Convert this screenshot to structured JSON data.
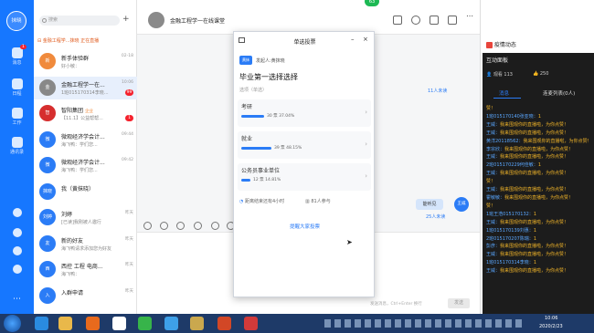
{
  "user": {
    "avatar_text": "抹晓"
  },
  "sidebar": {
    "items": [
      {
        "label": "消息",
        "badge": "1"
      },
      {
        "label": "日程"
      },
      {
        "label": "工作"
      },
      {
        "label": "通讯录"
      }
    ]
  },
  "search": {
    "placeholder": "搜索"
  },
  "pinned_notice": "金融工程学...抹晓 正在直播",
  "conversations": [
    {
      "name": "新手体验群",
      "msg": "好小敏：",
      "time": "02-18",
      "avatar": "新",
      "color": "#f08a3c"
    },
    {
      "name": "金融工程学一在...",
      "msg": "1班015170314李晓...",
      "time": "10:06",
      "badge": "99",
      "avatar": "金",
      "color": "#888888"
    },
    {
      "name": "智阳集团",
      "tag": "企业",
      "msg": "【11.1】公益帮帮...",
      "time": "",
      "badge": "1",
      "avatar": "智",
      "color": "#d62e2e"
    },
    {
      "name": "微观经济学会计...",
      "msg": "海飞鸭：学们您...",
      "time": "09:44",
      "avatar": "微",
      "color": "#2b7cf6"
    },
    {
      "name": "微观经济学会计...",
      "msg": "海飞鸭：学们您...",
      "time": "09:42",
      "avatar": "微",
      "color": "#2b7cf6"
    },
    {
      "name": "我（黄抹晓）",
      "msg": "",
      "time": "",
      "avatar": "抹晓",
      "color": "#2b7cf6"
    },
    {
      "name": "刘婷",
      "msg": "[已读]我刚被人邀行",
      "time": "昨天",
      "avatar": "刘婷",
      "color": "#2b7cf6"
    },
    {
      "name": "新的好友",
      "msg": "海飞鸭请求添加您为好友",
      "time": "昨天",
      "avatar": "友",
      "color": "#2b7cf6"
    },
    {
      "name": "西控 工程 电商...",
      "msg": "海飞鸭：",
      "time": "昨天",
      "avatar": "西",
      "color": "#2b7cf6"
    },
    {
      "name": "入群申请",
      "msg": "",
      "time": "昨天",
      "avatar": "入",
      "color": "#2b7cf6"
    }
  ],
  "chat": {
    "title": "金融工程学一在线课堂",
    "unread_top": "11人未读",
    "unread_bottom": "25人未读",
    "bubble": "能听见",
    "bubble_name": "王威",
    "input_hint": "发送消息，Ctrl+Enter 换行",
    "send": "发送"
  },
  "online_badge": "63",
  "poll": {
    "window_title": "单选投票",
    "author": "发起人:黄抹晓",
    "author_avatar": "黄抹",
    "question": "毕业第一选择选择",
    "type": "选项（单选）",
    "options": [
      {
        "label": "考研",
        "votes": "30 票",
        "pct_text": "37.04%",
        "pct": 37.04
      },
      {
        "label": "就业",
        "votes": "39 票",
        "pct_text": "48.15%",
        "pct": 48.15
      },
      {
        "label": "公务员事业单位",
        "votes": "12 票",
        "pct_text": "14.81%",
        "pct": 14.81
      }
    ],
    "deadline": "距离结束还有4小时",
    "participants": "81人参与",
    "remind": "提醒大家投票"
  },
  "right_panel": {
    "title": "疫情动态",
    "live_title": "互动面板",
    "viewers": "观看 113",
    "likes": "250",
    "tabs": [
      "消息",
      "连麦列表(0人)"
    ],
    "messages": [
      {
        "name": "",
        "text": "赞！"
      },
      {
        "name": "1班015170140张亚晓：",
        "text": "1"
      },
      {
        "name": "王威：",
        "text": "我来围观你的直播啦，为你点赞！"
      },
      {
        "name": "王威：",
        "text": "我来围观你的直播啦，为你点赞！"
      },
      {
        "name": "黄洋20118562：",
        "text": "我来围观你的直播啦，为你点赞！"
      },
      {
        "name": "李宗欣：",
        "text": "我来围观你的直播啦，为你点赞！"
      },
      {
        "name": "王威：",
        "text": "我来围观你的直播啦，为你点赞！"
      },
      {
        "name": "2班015170229何佳敏：",
        "text": "1"
      },
      {
        "name": "王威：",
        "text": "我来围观你的直播啦，为你点赞！"
      },
      {
        "name": "",
        "text": "赞！"
      },
      {
        "name": "王威：",
        "text": "我来围观你的直播啦，为你点赞！"
      },
      {
        "name": "霍敏敏：",
        "text": "我来围观你的直播啦，为你点赞！"
      },
      {
        "name": "",
        "text": "赞！"
      },
      {
        "name": "1班王浩015170132：",
        "text": "1"
      },
      {
        "name": "王威：",
        "text": "我来围观你的直播啦，为你点赞！"
      },
      {
        "name": "1班015170139刘惠：",
        "text": "1"
      },
      {
        "name": "2班015170207陈瑞：",
        "text": "1"
      },
      {
        "name": "彭彦：",
        "text": "我来围观你的直播啦，为你点赞！"
      },
      {
        "name": "王威：",
        "text": "我来围观你的直播啦，为你点赞！"
      },
      {
        "name": "1班015170314李晓：",
        "text": "1"
      },
      {
        "name": "王威：",
        "text": "我来围观你的直播啦，为你点赞！"
      }
    ]
  },
  "taskbar": {
    "time": "10:06",
    "date": "2020/2/23"
  }
}
